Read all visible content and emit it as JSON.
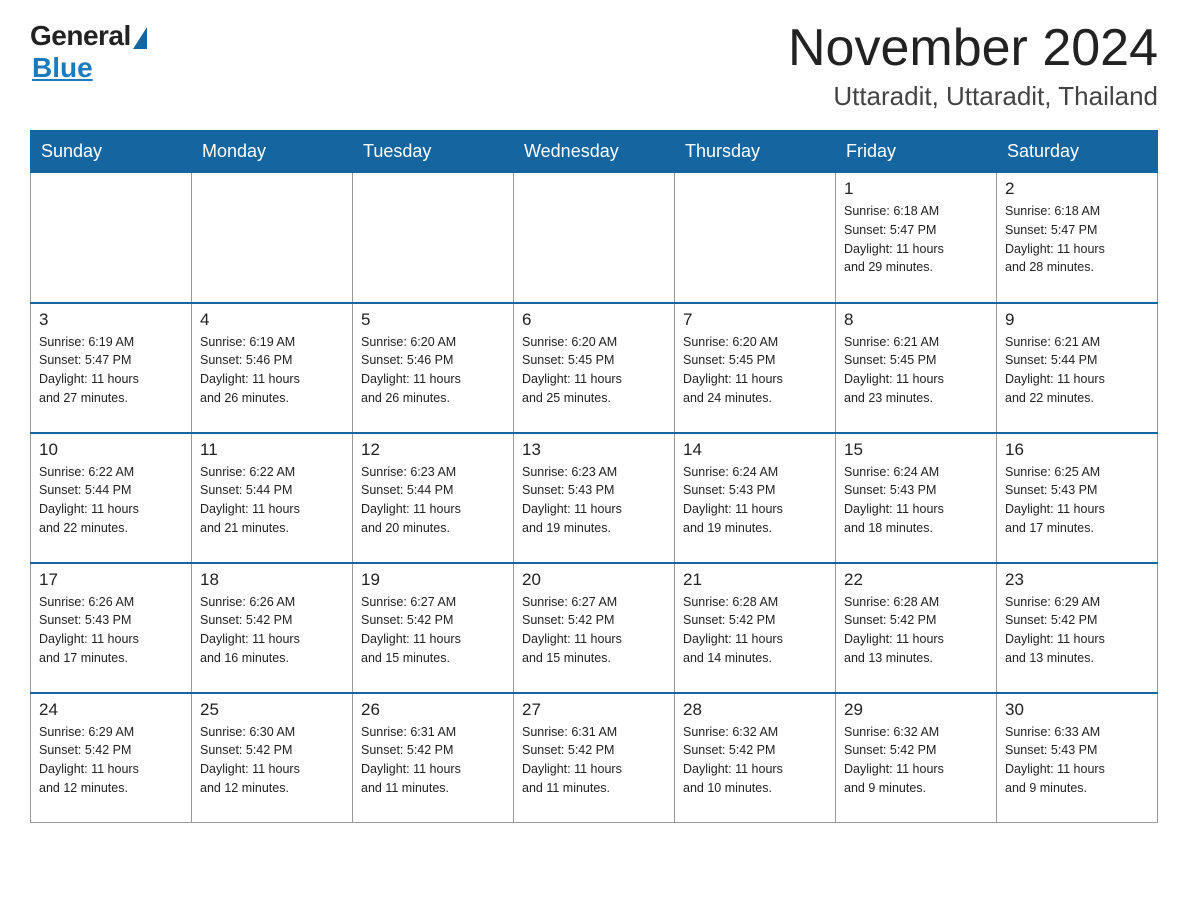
{
  "header": {
    "logo_general": "General",
    "logo_blue": "Blue",
    "month_title": "November 2024",
    "location": "Uttaradit, Uttaradit, Thailand"
  },
  "weekdays": [
    "Sunday",
    "Monday",
    "Tuesday",
    "Wednesday",
    "Thursday",
    "Friday",
    "Saturday"
  ],
  "weeks": [
    [
      {
        "day": "",
        "info": ""
      },
      {
        "day": "",
        "info": ""
      },
      {
        "day": "",
        "info": ""
      },
      {
        "day": "",
        "info": ""
      },
      {
        "day": "",
        "info": ""
      },
      {
        "day": "1",
        "info": "Sunrise: 6:18 AM\nSunset: 5:47 PM\nDaylight: 11 hours\nand 29 minutes."
      },
      {
        "day": "2",
        "info": "Sunrise: 6:18 AM\nSunset: 5:47 PM\nDaylight: 11 hours\nand 28 minutes."
      }
    ],
    [
      {
        "day": "3",
        "info": "Sunrise: 6:19 AM\nSunset: 5:47 PM\nDaylight: 11 hours\nand 27 minutes."
      },
      {
        "day": "4",
        "info": "Sunrise: 6:19 AM\nSunset: 5:46 PM\nDaylight: 11 hours\nand 26 minutes."
      },
      {
        "day": "5",
        "info": "Sunrise: 6:20 AM\nSunset: 5:46 PM\nDaylight: 11 hours\nand 26 minutes."
      },
      {
        "day": "6",
        "info": "Sunrise: 6:20 AM\nSunset: 5:45 PM\nDaylight: 11 hours\nand 25 minutes."
      },
      {
        "day": "7",
        "info": "Sunrise: 6:20 AM\nSunset: 5:45 PM\nDaylight: 11 hours\nand 24 minutes."
      },
      {
        "day": "8",
        "info": "Sunrise: 6:21 AM\nSunset: 5:45 PM\nDaylight: 11 hours\nand 23 minutes."
      },
      {
        "day": "9",
        "info": "Sunrise: 6:21 AM\nSunset: 5:44 PM\nDaylight: 11 hours\nand 22 minutes."
      }
    ],
    [
      {
        "day": "10",
        "info": "Sunrise: 6:22 AM\nSunset: 5:44 PM\nDaylight: 11 hours\nand 22 minutes."
      },
      {
        "day": "11",
        "info": "Sunrise: 6:22 AM\nSunset: 5:44 PM\nDaylight: 11 hours\nand 21 minutes."
      },
      {
        "day": "12",
        "info": "Sunrise: 6:23 AM\nSunset: 5:44 PM\nDaylight: 11 hours\nand 20 minutes."
      },
      {
        "day": "13",
        "info": "Sunrise: 6:23 AM\nSunset: 5:43 PM\nDaylight: 11 hours\nand 19 minutes."
      },
      {
        "day": "14",
        "info": "Sunrise: 6:24 AM\nSunset: 5:43 PM\nDaylight: 11 hours\nand 19 minutes."
      },
      {
        "day": "15",
        "info": "Sunrise: 6:24 AM\nSunset: 5:43 PM\nDaylight: 11 hours\nand 18 minutes."
      },
      {
        "day": "16",
        "info": "Sunrise: 6:25 AM\nSunset: 5:43 PM\nDaylight: 11 hours\nand 17 minutes."
      }
    ],
    [
      {
        "day": "17",
        "info": "Sunrise: 6:26 AM\nSunset: 5:43 PM\nDaylight: 11 hours\nand 17 minutes."
      },
      {
        "day": "18",
        "info": "Sunrise: 6:26 AM\nSunset: 5:42 PM\nDaylight: 11 hours\nand 16 minutes."
      },
      {
        "day": "19",
        "info": "Sunrise: 6:27 AM\nSunset: 5:42 PM\nDaylight: 11 hours\nand 15 minutes."
      },
      {
        "day": "20",
        "info": "Sunrise: 6:27 AM\nSunset: 5:42 PM\nDaylight: 11 hours\nand 15 minutes."
      },
      {
        "day": "21",
        "info": "Sunrise: 6:28 AM\nSunset: 5:42 PM\nDaylight: 11 hours\nand 14 minutes."
      },
      {
        "day": "22",
        "info": "Sunrise: 6:28 AM\nSunset: 5:42 PM\nDaylight: 11 hours\nand 13 minutes."
      },
      {
        "day": "23",
        "info": "Sunrise: 6:29 AM\nSunset: 5:42 PM\nDaylight: 11 hours\nand 13 minutes."
      }
    ],
    [
      {
        "day": "24",
        "info": "Sunrise: 6:29 AM\nSunset: 5:42 PM\nDaylight: 11 hours\nand 12 minutes."
      },
      {
        "day": "25",
        "info": "Sunrise: 6:30 AM\nSunset: 5:42 PM\nDaylight: 11 hours\nand 12 minutes."
      },
      {
        "day": "26",
        "info": "Sunrise: 6:31 AM\nSunset: 5:42 PM\nDaylight: 11 hours\nand 11 minutes."
      },
      {
        "day": "27",
        "info": "Sunrise: 6:31 AM\nSunset: 5:42 PM\nDaylight: 11 hours\nand 11 minutes."
      },
      {
        "day": "28",
        "info": "Sunrise: 6:32 AM\nSunset: 5:42 PM\nDaylight: 11 hours\nand 10 minutes."
      },
      {
        "day": "29",
        "info": "Sunrise: 6:32 AM\nSunset: 5:42 PM\nDaylight: 11 hours\nand 9 minutes."
      },
      {
        "day": "30",
        "info": "Sunrise: 6:33 AM\nSunset: 5:43 PM\nDaylight: 11 hours\nand 9 minutes."
      }
    ]
  ]
}
